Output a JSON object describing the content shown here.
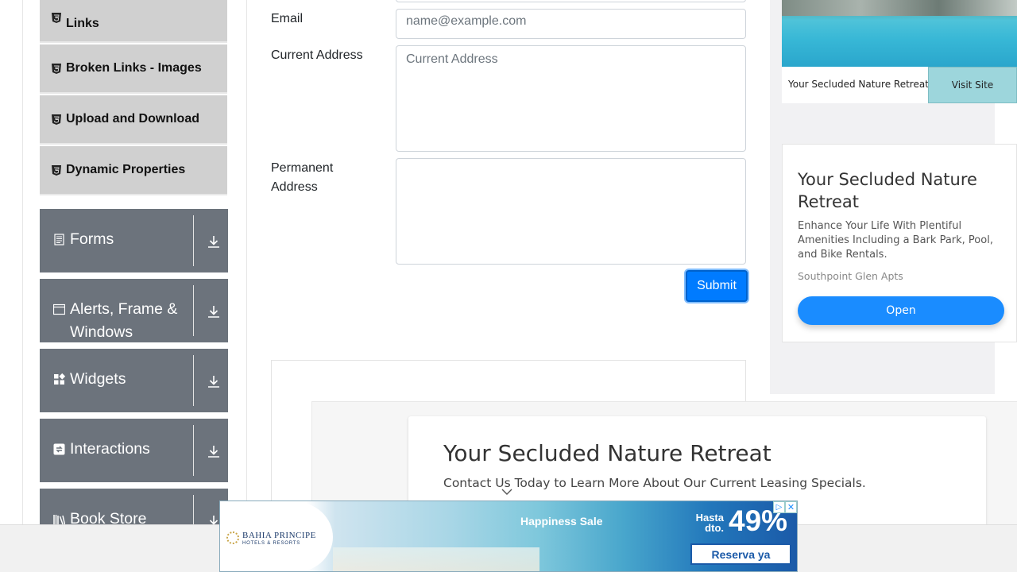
{
  "sidebar": {
    "element_items": [
      {
        "label": "Links",
        "icon": "html5-icon"
      },
      {
        "label": "Broken Links - Images",
        "icon": "html5-icon"
      },
      {
        "label": "Upload and Download",
        "icon": "html5-icon"
      },
      {
        "label": "Dynamic Properties",
        "icon": "html5-icon"
      }
    ],
    "groups": [
      {
        "label": "Forms",
        "icon": "form-icon"
      },
      {
        "label": "Alerts, Frame & Windows",
        "icon": "window-icon"
      },
      {
        "label": "Widgets",
        "icon": "widgets-icon"
      },
      {
        "label": "Interactions",
        "icon": "interactions-icon"
      },
      {
        "label": "Book Store Application",
        "icon": "books-icon"
      }
    ]
  },
  "form": {
    "email_label": "Email",
    "email_placeholder": "name@example.com",
    "current_address_label": "Current Address",
    "current_address_placeholder": "Current Address",
    "permanent_address_label": "Permanent Address",
    "permanent_address_value": "",
    "submit_label": "Submit"
  },
  "right_ad": {
    "strip_title": "Your Secluded Nature Retreat",
    "visit_label": "Visit Site",
    "headline": "Your Secluded Nature Retreat",
    "description": "Enhance Your Life With Plentiful Amenities Including a Bark Park, Pool, and Bike Rentals.",
    "source": "Southpoint Glen Apts",
    "open_label": "Open",
    "adchoices_glyph": "▷",
    "close_glyph": "✕"
  },
  "content_ad": {
    "headline": "Your Secluded Nature Retreat",
    "description": "Contact Us Today to Learn More About Our Current Leasing Specials."
  },
  "banner": {
    "brand": "BAHIA PRINCIPE",
    "brand_sub": "HOTELS & RESORTS",
    "sale": "Happiness Sale",
    "hasta": "Hasta dto.",
    "percent": "49%",
    "cta": "Reserva ya",
    "adchoices_glyph": "▷",
    "close_glyph": "✕"
  },
  "colors": {
    "sidebar_group_bg": "#6c737c",
    "sidebar_item_bg": "#d0d0d0",
    "primary": "#007bff",
    "ad_button": "#1a8cff"
  }
}
